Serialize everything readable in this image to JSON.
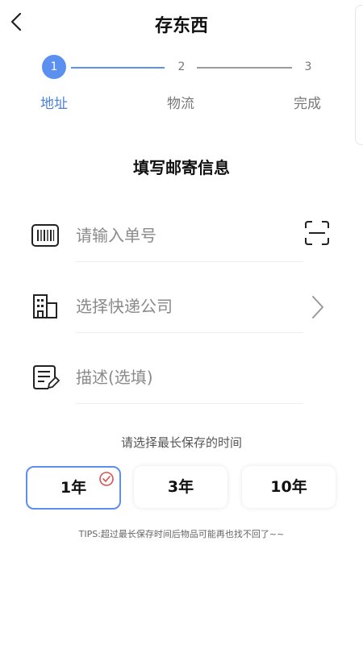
{
  "header": {
    "title": "存东西"
  },
  "steps": [
    {
      "number": "1",
      "label": "地址"
    },
    {
      "number": "2",
      "label": "物流"
    },
    {
      "number": "3",
      "label": "完成"
    }
  ],
  "form": {
    "section_title": "填写邮寄信息",
    "tracking_placeholder": "请输入单号",
    "courier_placeholder": "选择快递公司",
    "description_placeholder": "描述(选填)"
  },
  "storage": {
    "prompt": "请选择最长保存的时间",
    "options": [
      "1年",
      "3年",
      "10年"
    ],
    "selected": "1年"
  },
  "tips": "TIPS:超过最长保存时间后物品可能再也找不回了~~",
  "colors": {
    "accent": "#5b8ff0",
    "active_text": "#4a7fe0",
    "selected_check": "#d9534f"
  }
}
